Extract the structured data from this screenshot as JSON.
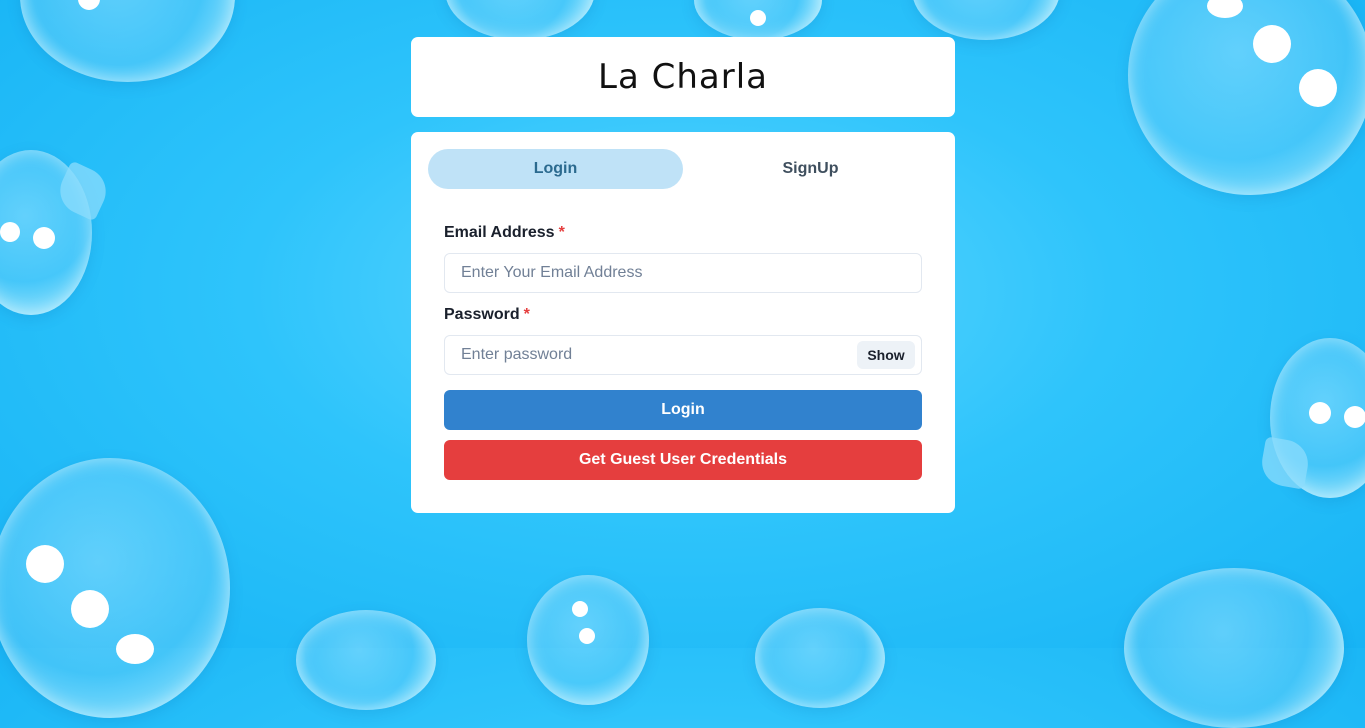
{
  "app": {
    "title": "La Charla"
  },
  "tabs": [
    {
      "label": "Login",
      "active": true
    },
    {
      "label": "SignUp",
      "active": false
    }
  ],
  "form": {
    "email": {
      "label": "Email Address",
      "required_mark": "*",
      "placeholder": "Enter Your Email Address",
      "value": ""
    },
    "password": {
      "label": "Password",
      "required_mark": "*",
      "placeholder": "Enter password",
      "value": "",
      "toggle_label": "Show"
    },
    "login_label": "Login",
    "guest_label": "Get Guest User Credentials"
  },
  "colors": {
    "background": "#17b4f5",
    "tab_active": "#bfe2f7",
    "login_button": "#3182ce",
    "guest_button": "#e53e3e",
    "required": "#e53e3e"
  }
}
